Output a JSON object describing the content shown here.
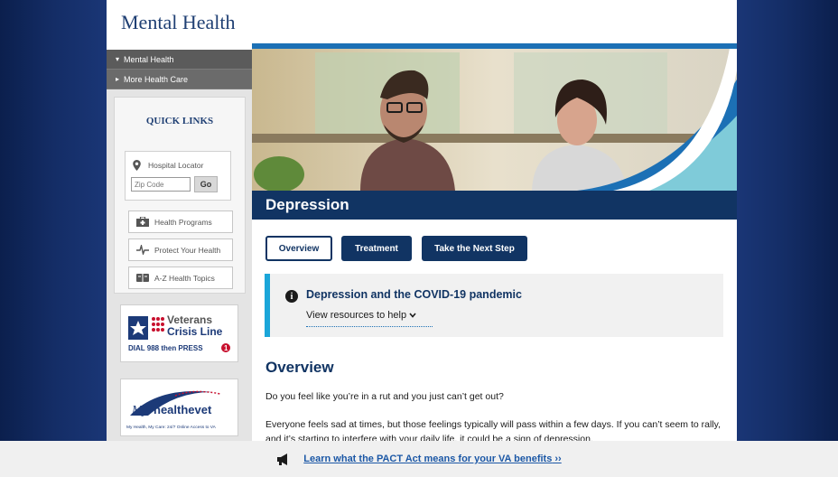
{
  "site_title": "Mental Health",
  "sidebar": {
    "nav": [
      {
        "label": "Mental Health",
        "caret": "▾"
      },
      {
        "label": "More Health Care",
        "caret": "▸"
      }
    ],
    "quick_links_title": "QUICK LINKS",
    "locator": {
      "label": "Hospital Locator",
      "zip_placeholder": "Zip Code",
      "go_label": "Go"
    },
    "buttons": [
      {
        "label": "Health Programs",
        "icon": "first-aid-kit-icon"
      },
      {
        "label": "Protect Your Health",
        "icon": "pulse-icon"
      },
      {
        "label": "A-Z Health Topics",
        "icon": "book-icon"
      }
    ],
    "crisis_line": {
      "title_1": "Veterans",
      "title_2": "Crisis Line",
      "dial": "DIAL 988 then PRESS"
    },
    "healthevet": {
      "brand_1": "My",
      "brand_2": "healthevet",
      "tagline": "My Health, My Care: 24/7 Online Access to VA"
    }
  },
  "hero": {
    "title": "Depression"
  },
  "tabs": [
    "Overview",
    "Treatment",
    "Take the Next Step"
  ],
  "alert": {
    "heading": "Depression and the COVID-19 pandemic",
    "toggle": "View resources to help"
  },
  "overview": {
    "heading": "Overview",
    "p1": "Do you feel like you’re in a rut and you just can’t get out?",
    "p2": "Everyone feels sad at times, but those feelings typically will pass within a few days. If you can’t seem to rally, and it’s starting to interfere with your daily life, it could be a sign of depression."
  },
  "banner": {
    "link_text": "Learn what the PACT Act means for your VA benefits"
  },
  "colors": {
    "navy": "#113463",
    "accent_blue": "#1c70b5",
    "alert_border": "#1ba6d9"
  }
}
